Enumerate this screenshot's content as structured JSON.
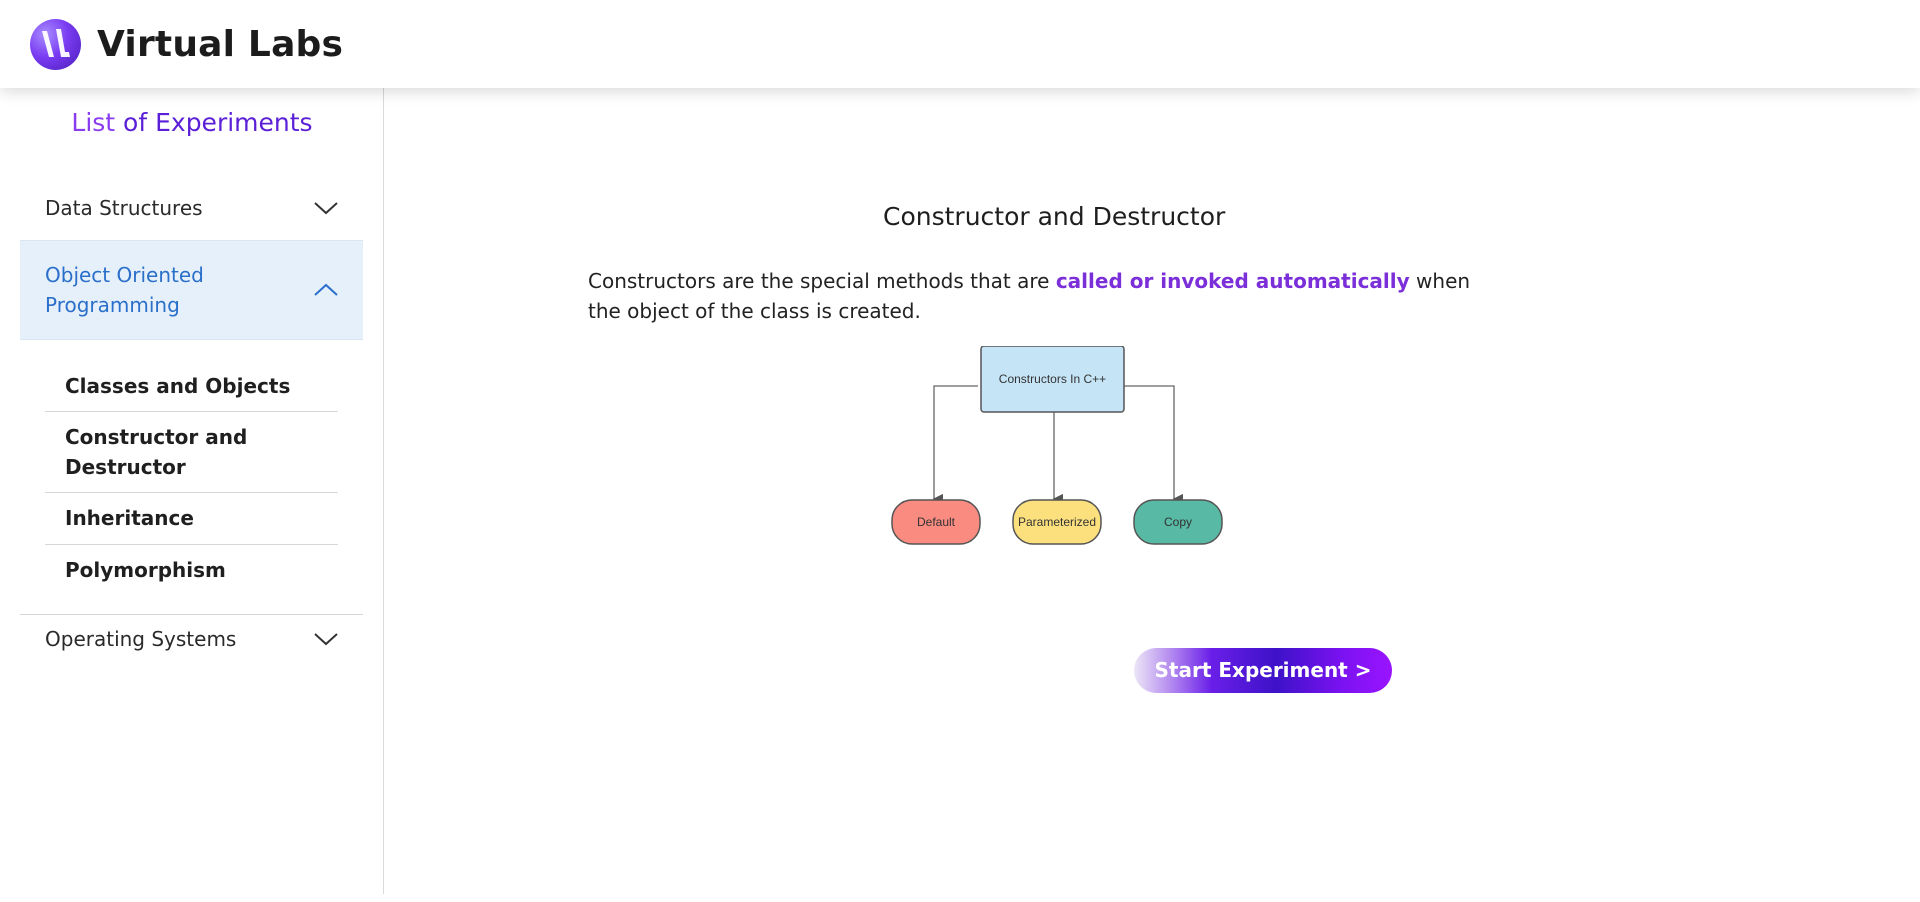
{
  "header": {
    "brand": "Virtual Labs",
    "logo_icon": "virtual-labs-logo"
  },
  "sidebar": {
    "title_part1": "List",
    "title_part2": " of Experiments",
    "categories": [
      {
        "label": "Data Structures",
        "expanded": false,
        "icon": "chevron-down-icon"
      },
      {
        "label": "Object Oriented Programming",
        "expanded": true,
        "icon": "chevron-up-icon"
      },
      {
        "label": "Operating Systems",
        "expanded": false,
        "icon": "chevron-down-icon"
      }
    ],
    "oop_items": [
      "Classes and Objects",
      "Constructor and Destructor",
      "Inheritance",
      "Polymorphism"
    ]
  },
  "main": {
    "title": "Constructor and Destructor",
    "description_pre": "Constructors are the special methods that are ",
    "description_highlight": "called or invoked automatically",
    "description_post": " when the object of the class is created.",
    "diagram": {
      "root": "Constructors In C++",
      "children": [
        "Default",
        "Parameterized",
        "Copy"
      ],
      "colors": {
        "root": "#c5e4f6",
        "default": "#f98b80",
        "parameterized": "#fce07d",
        "copy": "#58b9a4"
      }
    },
    "start_button": "Start Experiment >"
  },
  "colors": {
    "accent_purple": "#7b2fd9",
    "active_category_bg": "#e6f0fb",
    "active_category_text": "#2a6fc9"
  }
}
